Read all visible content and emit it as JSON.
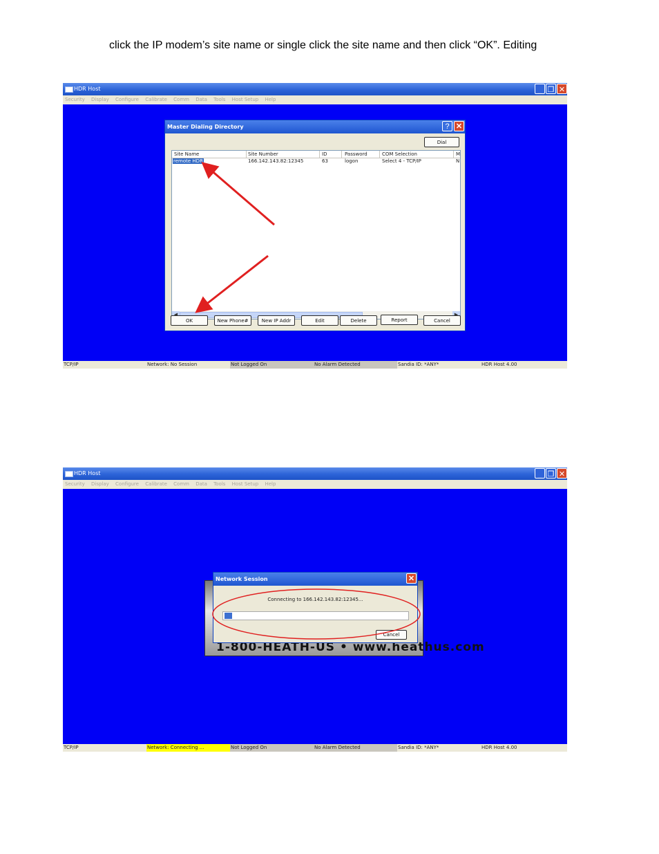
{
  "intro_text": "click the IP modem’s site name or single click the site name and then click “OK”. Editing",
  "app": {
    "title": "HDR Host",
    "menu": [
      "Security",
      "Display",
      "Configure",
      "Calibrate",
      "Comm",
      "Data",
      "Tools",
      "Host Setup",
      "Help"
    ]
  },
  "screen1": {
    "dialog_title": "Master Dialing Directory",
    "dial_label": "Dial",
    "columns": [
      "Site Name",
      "Site Number",
      "ID",
      "Password",
      "COM Selection",
      "M"
    ],
    "rows": [
      [
        "remote HDR",
        "166.142.143.82:12345",
        "63",
        "logon",
        "Select 4 - TCP/IP",
        "N"
      ]
    ],
    "buttons": [
      "OK",
      "New Phone#",
      "New IP Addr",
      "Edit",
      "Delete",
      "Report",
      "Cancel"
    ],
    "status": [
      "TCP/IP",
      "Network: No Session",
      "Not Logged On",
      "No Alarm Detected",
      "Sandia ID: *ANY*",
      "HDR Host 4.00"
    ]
  },
  "screen2": {
    "dialog_title": "Network Session",
    "message": "Connecting to 166.142.143.82:12345...",
    "progress": 0.04,
    "cancel_label": "Cancel",
    "splash_footer": "1-800-HEATH-US • www.heathus.com",
    "status": [
      "TCP/IP",
      "Network: Connecting ...",
      "Not Logged On",
      "No Alarm Detected",
      "Sandia ID: *ANY*",
      "HDR Host 4.00"
    ]
  },
  "colors": {
    "desktop": "#0000f6",
    "annotation": "#e02020",
    "status_highlight": "#ffff00"
  }
}
